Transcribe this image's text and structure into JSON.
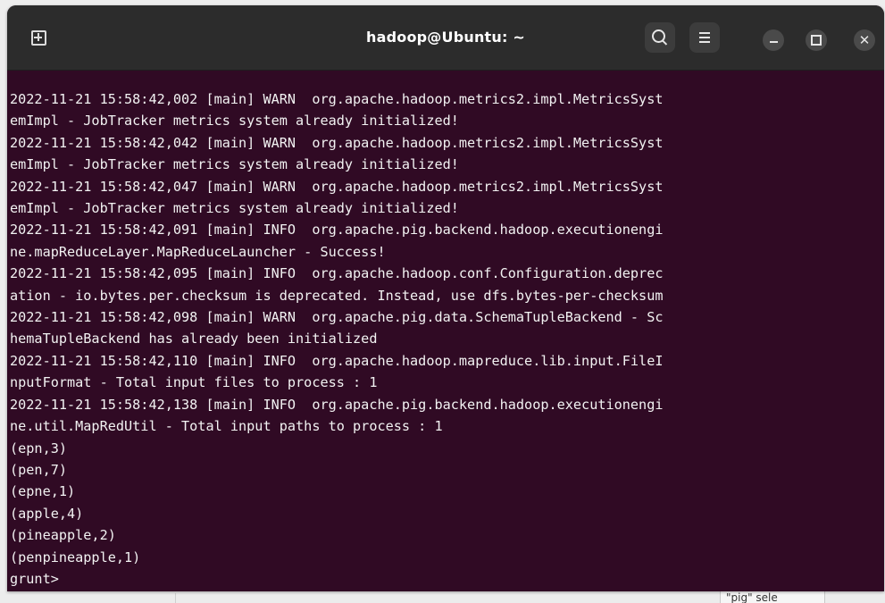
{
  "window": {
    "title": "hadoop@Ubuntu: ~",
    "colors": {
      "terminal_bg": "#300a24",
      "titlebar_bg": "#2c2c2c",
      "text": "#f2f2f2"
    }
  },
  "titlebar": {
    "icons": {
      "new_tab": "new-tab-icon",
      "search": "search-icon",
      "menu": "hamburger-menu-icon",
      "minimize": "minimize-icon",
      "maximize": "maximize-icon",
      "close": "close-icon"
    },
    "close_glyph": "✕"
  },
  "terminal": {
    "lines": [
      "2022-11-21 15:58:42,002 [main] WARN  org.apache.hadoop.metrics2.impl.MetricsSyst",
      "emImpl - JobTracker metrics system already initialized!",
      "2022-11-21 15:58:42,042 [main] WARN  org.apache.hadoop.metrics2.impl.MetricsSyst",
      "emImpl - JobTracker metrics system already initialized!",
      "2022-11-21 15:58:42,047 [main] WARN  org.apache.hadoop.metrics2.impl.MetricsSyst",
      "emImpl - JobTracker metrics system already initialized!",
      "2022-11-21 15:58:42,091 [main] INFO  org.apache.pig.backend.hadoop.executionengi",
      "ne.mapReduceLayer.MapReduceLauncher - Success!",
      "2022-11-21 15:58:42,095 [main] INFO  org.apache.hadoop.conf.Configuration.deprec",
      "ation - io.bytes.per.checksum is deprecated. Instead, use dfs.bytes-per-checksum",
      "2022-11-21 15:58:42,098 [main] WARN  org.apache.pig.data.SchemaTupleBackend - Sc",
      "hemaTupleBackend has already been initialized",
      "2022-11-21 15:58:42,110 [main] INFO  org.apache.hadoop.mapreduce.lib.input.FileI",
      "nputFormat - Total input files to process : 1",
      "2022-11-21 15:58:42,138 [main] INFO  org.apache.pig.backend.hadoop.executionengi",
      "ne.util.MapRedUtil - Total input paths to process : 1",
      "(epn,3)",
      "(pen,7)",
      "(epne,1)",
      "(apple,4)",
      "(pineapple,2)",
      "(penpineapple,1)"
    ],
    "prompt": "grunt>"
  },
  "background": {
    "snippet": "\"pig\" sele"
  }
}
